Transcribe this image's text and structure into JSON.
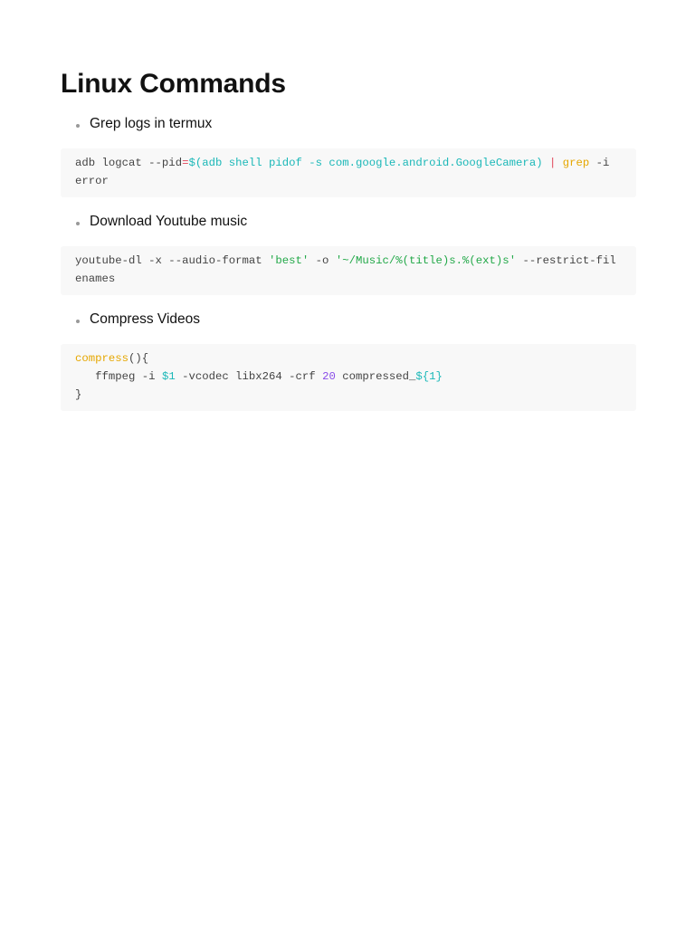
{
  "title": "Linux Commands",
  "sections": [
    {
      "label": "Grep logs in termux",
      "code": [
        [
          "plain",
          "adb logcat --pid"
        ],
        [
          "op",
          "="
        ],
        [
          "sub",
          "$(adb shell pidof -s com.google.android.GoogleCamera)"
        ],
        [
          "plain",
          " "
        ],
        [
          "op",
          "|"
        ],
        [
          "plain",
          " "
        ],
        [
          "cmd",
          "grep"
        ],
        [
          "plain",
          " -i error"
        ]
      ]
    },
    {
      "label": "Download Youtube music",
      "code": [
        [
          "plain",
          "youtube-dl -x --audio-format "
        ],
        [
          "str",
          "'best'"
        ],
        [
          "plain",
          " -o "
        ],
        [
          "str",
          "'~/Music/%(title)s.%(ext)s'"
        ],
        [
          "plain",
          " --restrict-filenames"
        ]
      ]
    },
    {
      "label": "Compress Videos",
      "code": [
        [
          "cmd",
          "compress"
        ],
        [
          "plain",
          "(){\n   ffmpeg -i "
        ],
        [
          "var",
          "$1"
        ],
        [
          "plain",
          " -vcodec libx264 -crf "
        ],
        [
          "num",
          "20"
        ],
        [
          "plain",
          " compressed_"
        ],
        [
          "var",
          "${1}"
        ],
        [
          "plain",
          "\n}"
        ]
      ]
    }
  ],
  "colors": {
    "operator": "#e0465a",
    "substitution": "#1bb8b8",
    "command": "#e6a700",
    "string": "#22a848",
    "number": "#8a4de8"
  }
}
